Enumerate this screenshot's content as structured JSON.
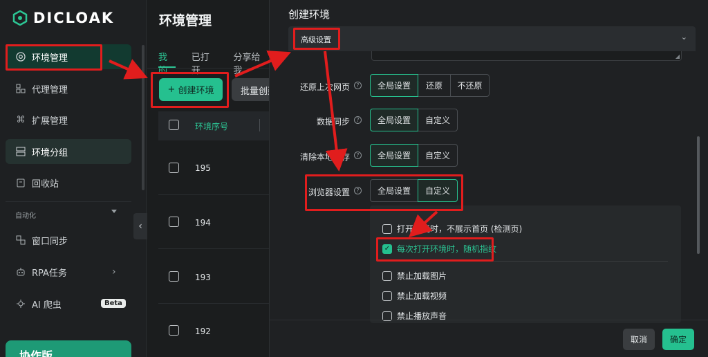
{
  "app": {
    "brand": "DICLOAK"
  },
  "sidebar": {
    "items": [
      {
        "label": "环境管理",
        "icon": "chrome-icon"
      },
      {
        "label": "代理管理",
        "icon": "proxy-icon"
      },
      {
        "label": "扩展管理",
        "icon": "command-icon"
      },
      {
        "label": "环境分组",
        "icon": "group-icon"
      },
      {
        "label": "回收站",
        "icon": "trash-icon"
      }
    ],
    "section": "自动化",
    "automation": [
      {
        "label": "窗口同步",
        "icon": "sync-icon"
      },
      {
        "label": "RPA任务",
        "icon": "robot-icon"
      },
      {
        "label": "AI 爬虫",
        "icon": "bug-icon",
        "badge": "Beta"
      }
    ],
    "collab_label": "协作版",
    "collapse_icon": "‹"
  },
  "main": {
    "title": "环境管理",
    "tabs": [
      "我的",
      "已打开",
      "分享给我"
    ],
    "create_button": "创建环境",
    "create_icon": "+",
    "batch_button": "批量创建",
    "column_header": "环境序号",
    "rows": [
      "195",
      "194",
      "193",
      "192"
    ]
  },
  "drawer": {
    "title": "创建环境",
    "section": "高级设置",
    "section_caret": "⌄",
    "fields": [
      {
        "label": "还原上次网页",
        "options": [
          "全局设置",
          "还原",
          "不还原"
        ],
        "selected": 0
      },
      {
        "label": "数据同步",
        "options": [
          "全局设置",
          "自定义"
        ],
        "selected": 0
      },
      {
        "label": "清除本地缓存",
        "options": [
          "全局设置",
          "自定义"
        ],
        "selected": 0
      },
      {
        "label": "浏览器设置",
        "options": [
          "全局设置",
          "自定义"
        ],
        "selected": 1
      }
    ],
    "help_icon": "?",
    "browser_options": [
      {
        "label": "打开环境时，不展示首页 (检测页)",
        "checked": false
      },
      {
        "label": "每次打开环境时，随机指纹",
        "checked": true
      },
      {
        "label": "禁止加载图片",
        "checked": false
      },
      {
        "label": "禁止加载视频",
        "checked": false
      },
      {
        "label": "禁止播放声音",
        "checked": false
      }
    ],
    "check_mark": "✓",
    "cancel_button": "取消",
    "ok_button": "确定"
  },
  "colors": {
    "accent": "#25c08f",
    "annotation": "#e11d1d",
    "background": "#1b1d1e"
  }
}
